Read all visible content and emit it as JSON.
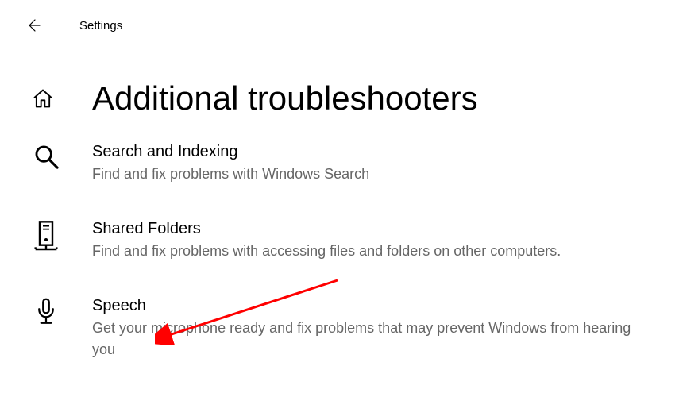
{
  "header": {
    "title": "Settings"
  },
  "page": {
    "title": "Additional troubleshooters"
  },
  "items": [
    {
      "title": "Search and Indexing",
      "desc": "Find and fix problems with Windows Search"
    },
    {
      "title": "Shared Folders",
      "desc": "Find and fix problems with accessing files and folders on other computers."
    },
    {
      "title": "Speech",
      "desc": "Get your microphone ready and fix problems that may prevent Windows from hearing you"
    }
  ]
}
